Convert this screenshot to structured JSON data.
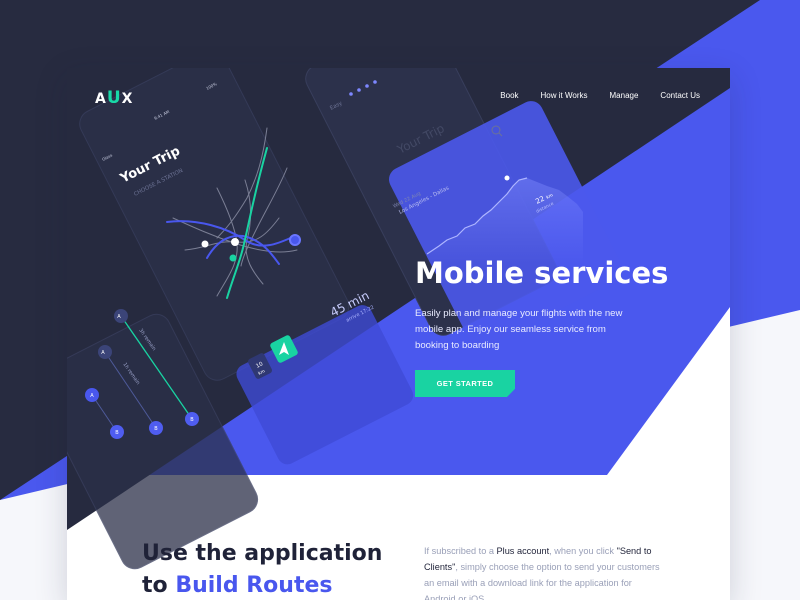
{
  "brand": {
    "logo_a": "A",
    "logo_u": "U",
    "logo_x": "X"
  },
  "nav": {
    "items": [
      "Book",
      "How it Works",
      "Manage",
      "Contact Us"
    ]
  },
  "hero": {
    "title": "Mobile services",
    "description": "Easily plan and manage your flights with the new mobile app. Enjoy our seamless service from booking to boarding",
    "cta_label": "GET STARTED"
  },
  "mockup": {
    "trip_title": "Your Trip",
    "trip_subtitle": "CHOOSE A STATION",
    "trip_title_right": "Your Trip",
    "status_signal": "Glass",
    "status_time": "9:41 AM",
    "status_battery": "100%",
    "route_label": "Los Angeles - Dallas",
    "route_date": "Wed 22 Aug",
    "duration": "45 min",
    "arrive": "arrive 17:22",
    "distance_value": "10",
    "distance_unit": "km",
    "chart_value": "22",
    "chart_unit": "km",
    "chart_caption": "distance",
    "easy_label": "Easy",
    "stop_a1": "A",
    "stop_a2": "A",
    "stop_a3": "A",
    "stop_b1": "B",
    "stop_b2": "B",
    "stop_b3": "B",
    "walk1": "3h remain",
    "walk2": "1h remain"
  },
  "section": {
    "title_line1": "Use the application",
    "title_line2_prefix": "to",
    "title_line2_accent": "Build Routes",
    "text_1": "If subscribed to a",
    "text_plus": "Plus account",
    "text_2": ", when you click",
    "text_send": "\"Send to Clients\"",
    "text_3": ", simply choose the option to send your customers an email with a download link for the application for Android or iOS."
  },
  "colors": {
    "dark": "#272b40",
    "blue": "#4957ee",
    "green": "#19d3a2",
    "white": "#ffffff"
  }
}
